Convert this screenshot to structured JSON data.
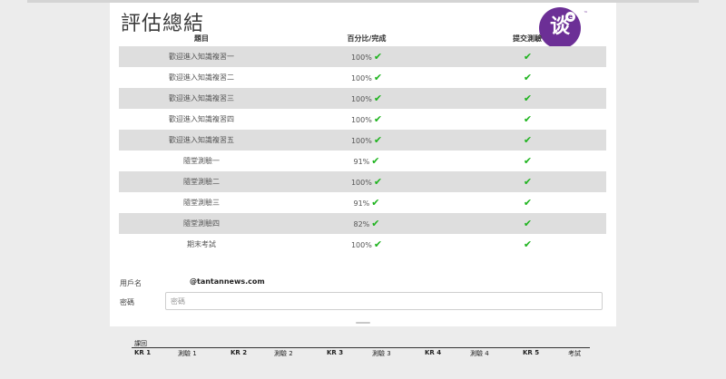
{
  "assessment": {
    "title": "評估總結",
    "headers": {
      "topic": "題目",
      "percent": "百分比/完成",
      "submitted": "提交測驗"
    },
    "check_color": "#1db31d",
    "rows": [
      {
        "topic": "歡迎進入知識複習一",
        "percent": "100%",
        "percent_check": "✔",
        "submitted_check": "✔"
      },
      {
        "topic": "歡迎進入知識複習二",
        "percent": "100%",
        "percent_check": "✔",
        "submitted_check": "✔"
      },
      {
        "topic": "歡迎進入知識複習三",
        "percent": "100%",
        "percent_check": "✔",
        "submitted_check": "✔"
      },
      {
        "topic": "歡迎進入知識複習四",
        "percent": "100%",
        "percent_check": "✔",
        "submitted_check": "✔"
      },
      {
        "topic": "歡迎進入知識複習五",
        "percent": "100%",
        "percent_check": "✔",
        "submitted_check": "✔"
      },
      {
        "topic": "隨堂測驗一",
        "percent": "91%",
        "percent_check": "✔",
        "submitted_check": "✔"
      },
      {
        "topic": "隨堂測驗二",
        "percent": "100%",
        "percent_check": "✔",
        "submitted_check": "✔"
      },
      {
        "topic": "隨堂測驗三",
        "percent": "91%",
        "percent_check": "✔",
        "submitted_check": "✔"
      },
      {
        "topic": "隨堂測驗四",
        "percent": "82%",
        "percent_check": "✔",
        "submitted_check": "✔"
      },
      {
        "topic": "期末考試",
        "percent": "100%",
        "percent_check": "✔",
        "submitted_check": "✔"
      }
    ]
  },
  "login": {
    "username_label": "用戶名",
    "username_value": "@tantannews.com",
    "password_label": "密碼",
    "password_placeholder": "密碼"
  },
  "logo": {
    "char": "谈",
    "sup": "e",
    "mark": "™",
    "color": "#6c2f96"
  },
  "bottom": {
    "title": "課回",
    "items": [
      {
        "label": "KR 1",
        "bold": true
      },
      {
        "label": "測驗 1",
        "bold": false
      },
      {
        "label": "KR 2",
        "bold": true
      },
      {
        "label": "測驗 2",
        "bold": false
      },
      {
        "label": "KR 3",
        "bold": true
      },
      {
        "label": "測驗 3",
        "bold": false
      },
      {
        "label": "KR 4",
        "bold": true
      },
      {
        "label": "測驗 4",
        "bold": false
      },
      {
        "label": "KR 5",
        "bold": true
      },
      {
        "label": "考試",
        "bold": false
      }
    ]
  }
}
